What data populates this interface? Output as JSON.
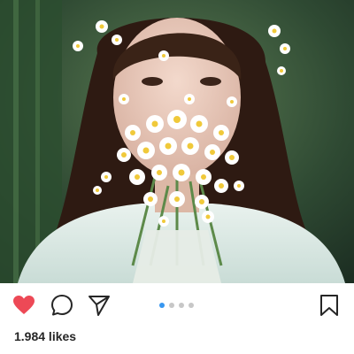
{
  "post": {
    "image_description_icon": "portrait-photo",
    "carousel": {
      "count": 4,
      "active_index": 0
    },
    "actions": {
      "like_icon": "heart-icon",
      "comment_icon": "comment-icon",
      "share_icon": "send-icon",
      "save_icon": "bookmark-icon",
      "liked": true
    },
    "likes_text": "1.984 likes"
  },
  "colors": {
    "like_active": "#ed4956",
    "dot_active": "#3897f0",
    "dot_inactive": "#c7c7c7",
    "icon_stroke": "#262626"
  }
}
